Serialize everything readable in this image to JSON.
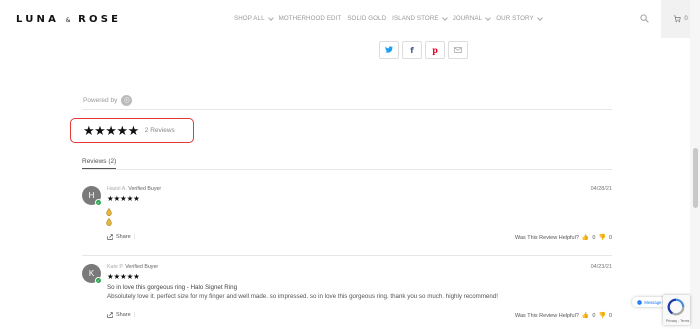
{
  "header": {
    "logo_main": "LUNA",
    "logo_amp": "&",
    "logo_second": "ROSE",
    "nav": [
      {
        "label": "SHOP ALL",
        "has_chevron": true
      },
      {
        "label": "MOTHERHOOD EDIT",
        "has_chevron": false
      },
      {
        "label": "SOLID GOLD",
        "has_chevron": false
      },
      {
        "label": "ISLAND STORE",
        "has_chevron": true
      },
      {
        "label": "JOURNAL",
        "has_chevron": true
      },
      {
        "label": "OUR STORY",
        "has_chevron": true
      }
    ],
    "cart_count": "0"
  },
  "share_buttons": [
    {
      "icon": "twitter-icon",
      "glyph": "t",
      "color": "#1da1f2"
    },
    {
      "icon": "facebook-icon",
      "glyph": "f",
      "color": "#3b5998"
    },
    {
      "icon": "pinterest-icon",
      "glyph": "p",
      "color": "#e60023"
    },
    {
      "icon": "email-icon",
      "glyph": "✉",
      "color": "#999999"
    }
  ],
  "reviews_widget": {
    "powered_by": "Powered by",
    "summary_stars": "★★★★★",
    "summary_count": "2 Reviews",
    "tab_label": "Reviews (2)",
    "highlight_color": "#e53935"
  },
  "reviews": [
    {
      "initial": "H",
      "name": "Hazel A.",
      "badge": "Verified Buyer",
      "stars": "★★★★★",
      "date": "04/28/21",
      "share": "Share",
      "helpful_label": "Was This Review Helpful?",
      "up_count": "0",
      "down_count": "0"
    },
    {
      "initial": "K",
      "name": "Kate P.",
      "badge": "Verified Buyer",
      "stars": "★★★★★",
      "date": "04/23/21",
      "title": "So in love this gorgeous ring - Halo Signet Ring",
      "body": "Absolutely love it. perfect size for my finger and well made. so impressed. so in love this gorgeous ring. thank you so much. highly recommend!",
      "share": "Share",
      "helpful_label": "Was This Review Helpful?",
      "up_count": "0",
      "down_count": "0"
    }
  ],
  "widgets": {
    "messenger_label": "Message Us",
    "captcha_links": "Privacy - Terms"
  }
}
